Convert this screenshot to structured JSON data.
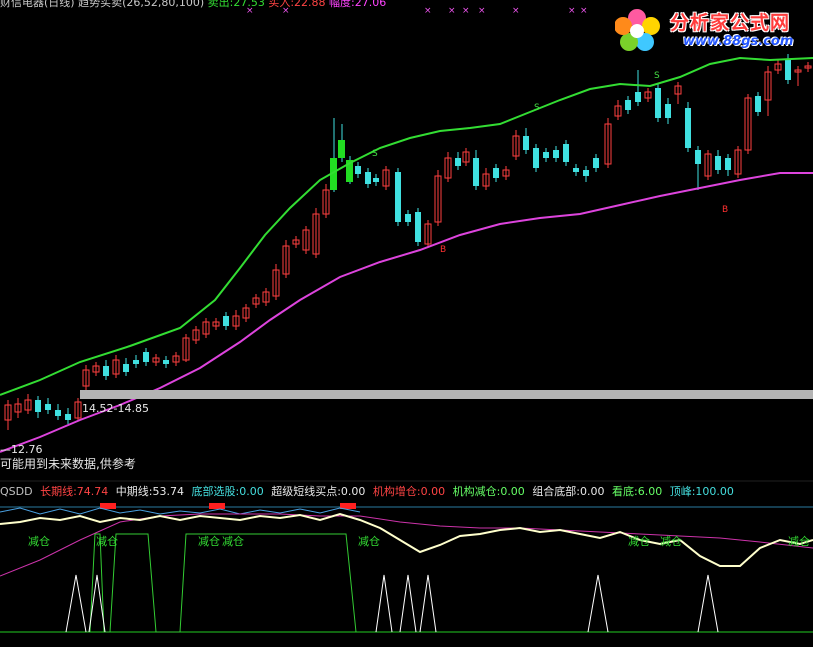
{
  "main": {
    "title_prefix": "财信电器(日线) 趋势买卖(26,52,80,100)",
    "sell_label": "卖出:27.53",
    "buy_label": "买入:22.88",
    "amplitude_label": "幅度:27.06",
    "range_label": "14.52-14.85",
    "low_label": "12.76",
    "warning_text": "可能用到未来数据,供参考",
    "signal_s": "S",
    "signal_b": "B",
    "x_marks": "×",
    "colors": {
      "up_candle": "#ff4040",
      "down_candle": "#40e0e0",
      "upper_band": "#33dd33",
      "lower_band": "#dd44dd",
      "gray_bar": "#b4b4b4"
    }
  },
  "indicator": {
    "name": "QSDD",
    "long_line": "长期线:74.74",
    "mid_line": "中期线:53.74",
    "bottom_pick": "底部选股:0.00",
    "short_buy": "超级短线买点:0.00",
    "inst_add": "机构增仓:0.00",
    "inst_reduce": "机构减仓:0.00",
    "combo_bottom": "组合底部:0.00",
    "look_bottom": "看底:6.00",
    "top": "顶峰:100.00",
    "reduce_label": "减仓"
  },
  "logo": {
    "title": "分析家公式网",
    "url": "www.88gs.com"
  }
}
